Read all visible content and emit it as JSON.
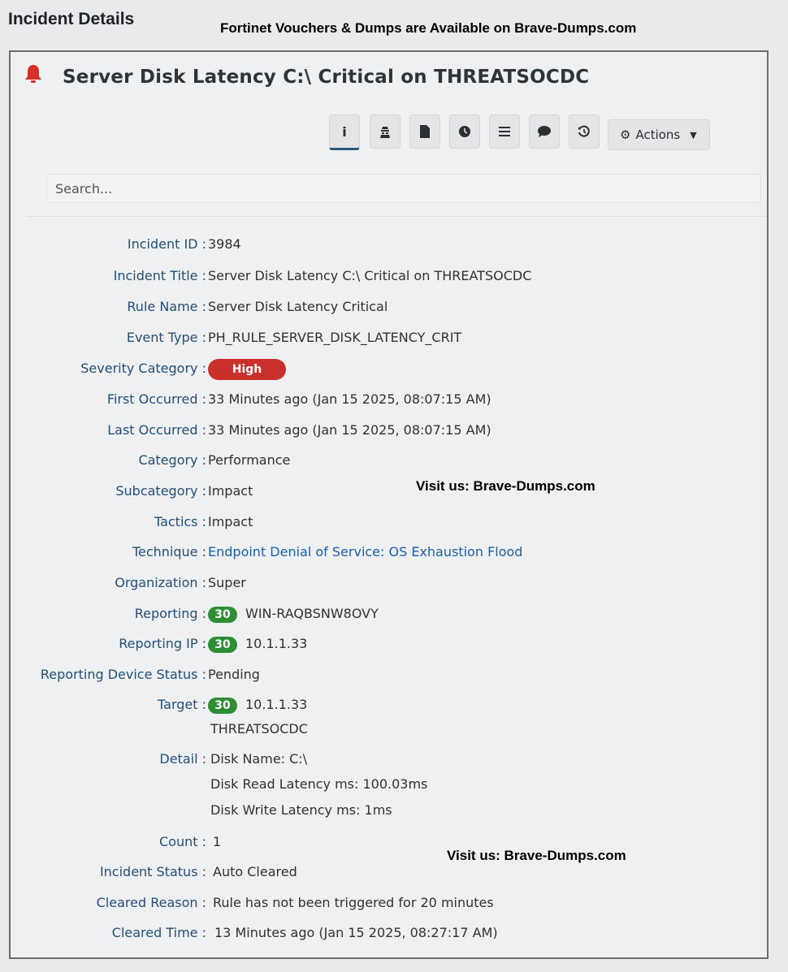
{
  "page": {
    "title": "Incident Details",
    "banner": "Fortinet Vouchers & Dumps are Available on Brave-Dumps.com",
    "watermark1": "Visit us: Brave-Dumps.com",
    "watermark2": "Visit us: Brave-Dumps.com"
  },
  "incident": {
    "heading": "Server Disk Latency C:\\ Critical on THREATSOCDC",
    "bell_color": "#d9302c"
  },
  "toolbar": {
    "buttons": [
      "info-icon",
      "user-secret-icon",
      "document-icon",
      "clock-icon",
      "list-icon",
      "comment-icon",
      "history-icon"
    ],
    "actions_label": "Actions"
  },
  "search": {
    "placeholder": "Search..."
  },
  "fields": {
    "incident_id": {
      "label": "Incident ID :",
      "value": "3984"
    },
    "incident_title": {
      "label": "Incident Title :",
      "value": "Server Disk Latency C:\\ Critical on THREATSOCDC"
    },
    "rule_name": {
      "label": "Rule Name :",
      "value": "Server Disk Latency Critical"
    },
    "event_type": {
      "label": "Event Type :",
      "value": "PH_RULE_SERVER_DISK_LATENCY_CRIT"
    },
    "severity": {
      "label": "Severity Category :",
      "value": "High",
      "color": "#c9302c"
    },
    "first_occurred": {
      "label": "First Occurred :",
      "value": "33 Minutes ago (Jan 15 2025, 08:07:15 AM)"
    },
    "last_occurred": {
      "label": "Last Occurred :",
      "value": "33 Minutes ago (Jan 15 2025, 08:07:15 AM)"
    },
    "category": {
      "label": "Category :",
      "value": "Performance"
    },
    "subcategory": {
      "label": "Subcategory :",
      "value": "Impact"
    },
    "tactics": {
      "label": "Tactics :",
      "value": "Impact"
    },
    "technique": {
      "label": "Technique :",
      "value": "Endpoint Denial of Service: OS Exhaustion Flood"
    },
    "organization": {
      "label": "Organization :",
      "value": "Super"
    },
    "reporting": {
      "label": "Reporting :",
      "count": "30",
      "value": "WIN-RAQBSNW8OVY"
    },
    "reporting_ip": {
      "label": "Reporting IP :",
      "count": "30",
      "value": "10.1.1.33"
    },
    "reporting_device_status": {
      "label": "Reporting Device Status :",
      "value": "Pending"
    },
    "target": {
      "label": "Target :",
      "count": "30",
      "value": "10.1.1.33",
      "value2": "THREATSOCDC"
    },
    "detail": {
      "label": "Detail :",
      "line1": "Disk Name: C:\\",
      "line2": "Disk Read Latency ms: 100.03ms",
      "line3": "Disk Write Latency ms: 1ms"
    },
    "count": {
      "label": "Count :",
      "value": "1"
    },
    "incident_status": {
      "label": "Incident Status :",
      "value": "Auto Cleared"
    },
    "cleared_reason": {
      "label": "Cleared Reason :",
      "value": "Rule has not been triggered for 20 minutes"
    },
    "cleared_time": {
      "label": "Cleared Time :",
      "value": "13 Minutes ago (Jan 15 2025, 08:27:17 AM)"
    }
  }
}
